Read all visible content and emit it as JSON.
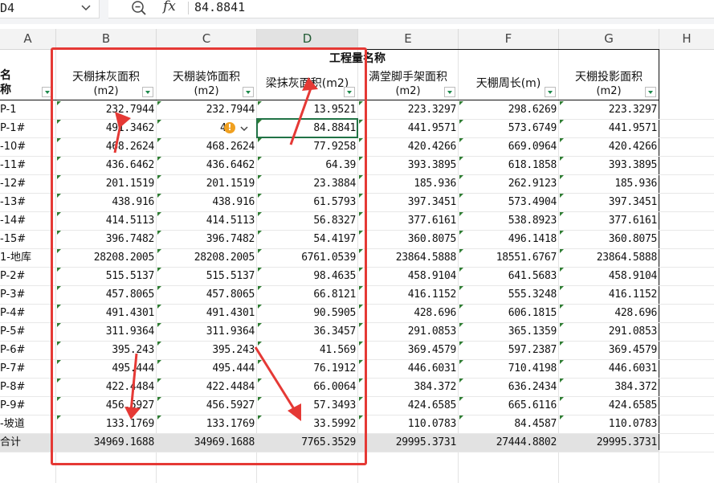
{
  "namebox": {
    "value": "D4"
  },
  "formula": {
    "value": "84.8841"
  },
  "icons": {
    "dropdown": "chevron-down-icon",
    "zoom": "zoom-icon",
    "fx": "fx-icon"
  },
  "fx_label": "fx",
  "columns": [
    "A",
    "B",
    "C",
    "D",
    "E",
    "F",
    "G",
    "H"
  ],
  "selected_column": "D",
  "sheet": {
    "group_header": "工程量名称",
    "name_header": "名称",
    "headers": [
      {
        "title": "天棚抹灰面积",
        "unit": "(m2)"
      },
      {
        "title": "天棚装饰面积",
        "unit": "(m2)"
      },
      {
        "title": "梁抹灰面积(m2)",
        "unit": ""
      },
      {
        "title": "满堂脚手架面积",
        "unit": "(m2)"
      },
      {
        "title": "天棚周长(m)",
        "unit": ""
      },
      {
        "title": "天棚投影面积",
        "unit": "(m2)"
      }
    ],
    "rows": [
      {
        "name": "P-1",
        "values": [
          "232.7944",
          "232.7944",
          "13.9521",
          "223.3297",
          "298.6269",
          "223.3297"
        ]
      },
      {
        "name": "P-1#",
        "values": [
          "491.3462",
          "49",
          "84.8841",
          "441.9571",
          "573.6749",
          "441.9571"
        ]
      },
      {
        "name": "-10#",
        "values": [
          "468.2624",
          "468.2624",
          "77.9258",
          "420.4266",
          "669.0964",
          "420.4266"
        ]
      },
      {
        "name": "-11#",
        "values": [
          "436.6462",
          "436.6462",
          "64.39",
          "393.3895",
          "618.1858",
          "393.3895"
        ]
      },
      {
        "name": "-12#",
        "values": [
          "201.1519",
          "201.1519",
          "23.3884",
          "185.936",
          "262.9123",
          "185.936"
        ]
      },
      {
        "name": "-13#",
        "values": [
          "438.916",
          "438.916",
          "61.5793",
          "397.3451",
          "573.4904",
          "397.3451"
        ]
      },
      {
        "name": "-14#",
        "values": [
          "414.5113",
          "414.5113",
          "56.8327",
          "377.6161",
          "538.8923",
          "377.6161"
        ]
      },
      {
        "name": "-15#",
        "values": [
          "396.7482",
          "396.7482",
          "54.4197",
          "360.8075",
          "496.1418",
          "360.8075"
        ]
      },
      {
        "name": "1-地库",
        "values": [
          "28208.2005",
          "28208.2005",
          "6761.0539",
          "23864.5888",
          "18551.6767",
          "23864.5888"
        ]
      },
      {
        "name": "P-2#",
        "values": [
          "515.5137",
          "515.5137",
          "98.4635",
          "458.9104",
          "641.5683",
          "458.9104"
        ]
      },
      {
        "name": "P-3#",
        "values": [
          "457.8065",
          "457.8065",
          "66.8121",
          "416.1152",
          "555.3248",
          "416.1152"
        ]
      },
      {
        "name": "P-4#",
        "values": [
          "491.4301",
          "491.4301",
          "90.5905",
          "428.696",
          "606.1815",
          "428.696"
        ]
      },
      {
        "name": "P-5#",
        "values": [
          "311.9364",
          "311.9364",
          "36.3457",
          "291.0853",
          "365.1359",
          "291.0853"
        ]
      },
      {
        "name": "P-6#",
        "values": [
          "395.243",
          "395.243",
          "41.569",
          "369.4579",
          "597.2387",
          "369.4579"
        ]
      },
      {
        "name": "P-7#",
        "values": [
          "495.444",
          "495.444",
          "76.1912",
          "446.6031",
          "710.4198",
          "446.6031"
        ]
      },
      {
        "name": "P-8#",
        "values": [
          "422.4484",
          "422.4484",
          "66.0064",
          "384.372",
          "636.2434",
          "384.372"
        ]
      },
      {
        "name": "P-9#",
        "values": [
          "456.5927",
          "456.5927",
          "57.3493",
          "424.6585",
          "665.6116",
          "424.6585"
        ]
      },
      {
        "name": "-坡道",
        "values": [
          "133.1769",
          "133.1769",
          "33.5992",
          "110.0783",
          "84.4587",
          "110.0783"
        ]
      }
    ],
    "total": {
      "name": "合计",
      "values": [
        "34969.1688",
        "34969.1688",
        "7765.3529",
        "29995.3731",
        "27444.8802",
        "29995.3731"
      ]
    }
  },
  "annotation_color": "#e53935",
  "selection_color": "#217346",
  "warning_badge": "!"
}
